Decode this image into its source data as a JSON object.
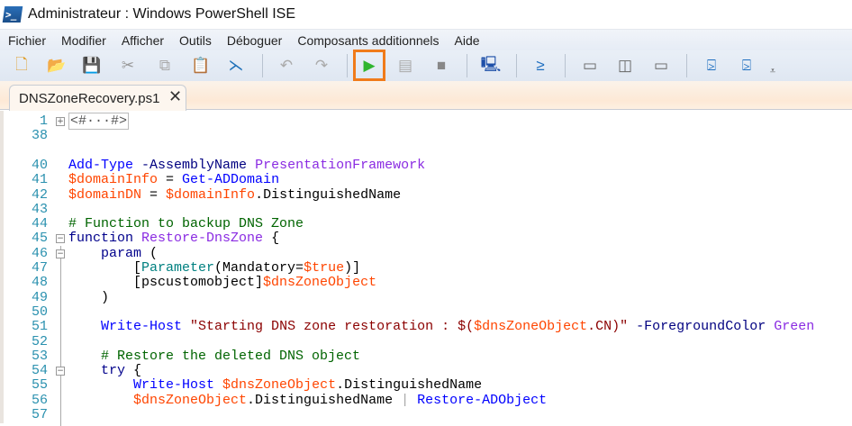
{
  "window": {
    "title": "Administrateur : Windows PowerShell ISE"
  },
  "menu": [
    "Fichier",
    "Modifier",
    "Afficher",
    "Outils",
    "Déboguer",
    "Composants additionnels",
    "Aide"
  ],
  "toolbar": [
    {
      "name": "new-file",
      "glyph": "🗋",
      "color": "#e0a030"
    },
    {
      "name": "open-file",
      "glyph": "📂",
      "color": "#d9a640"
    },
    {
      "name": "save",
      "glyph": "💾",
      "color": "#1f5fa8"
    },
    {
      "name": "cut",
      "glyph": "✂",
      "color": "#999"
    },
    {
      "name": "copy",
      "glyph": "⧉",
      "color": "#aaa"
    },
    {
      "name": "paste",
      "glyph": "📋",
      "color": "#333"
    },
    {
      "name": "clear-console",
      "glyph": "⋋",
      "color": "#1c6fb8"
    },
    {
      "name": "undo",
      "glyph": "↶",
      "color": "#aaa"
    },
    {
      "name": "redo",
      "glyph": "↷",
      "color": "#aaa"
    },
    {
      "name": "run-script",
      "glyph": "▶",
      "color": "#2fb52f"
    },
    {
      "name": "run-selection",
      "glyph": "▤",
      "color": "#aaa"
    },
    {
      "name": "stop",
      "glyph": "■",
      "color": "#888"
    },
    {
      "name": "remote-tab",
      "glyph": "🖳",
      "color": "#1d4fa8"
    },
    {
      "name": "start-powershell",
      "glyph": "≥",
      "color": "#1f6fc0"
    },
    {
      "name": "show-script-top",
      "glyph": "▭",
      "color": "#666"
    },
    {
      "name": "show-script-right",
      "glyph": "◫",
      "color": "#666"
    },
    {
      "name": "show-script-maximized",
      "glyph": "▭",
      "color": "#666"
    },
    {
      "name": "show-console-top",
      "glyph": "⍄",
      "color": "#1f6fc0"
    },
    {
      "name": "show-console-right",
      "glyph": "⍄",
      "color": "#1f6fc0"
    }
  ],
  "tab": {
    "label": "DNSZoneRecovery.ps1",
    "close": "✕"
  },
  "code": [
    {
      "n": "1",
      "fold": "+",
      "t": [
        [
          "<#···#>",
          "collapsed"
        ]
      ]
    },
    {
      "n": "38",
      "t": []
    },
    {
      "n": "",
      "t": []
    },
    {
      "n": "40",
      "t": [
        [
          "Add-Type",
          "cmd"
        ],
        [
          " ",
          "plain"
        ],
        [
          "-AssemblyName",
          "par"
        ],
        [
          " ",
          "plain"
        ],
        [
          "PresentationFramework",
          "arg"
        ]
      ]
    },
    {
      "n": "41",
      "t": [
        [
          "$domainInfo",
          "var"
        ],
        [
          " = ",
          "plain"
        ],
        [
          "Get-ADDomain",
          "cmd"
        ]
      ]
    },
    {
      "n": "42",
      "t": [
        [
          "$domainDN",
          "var"
        ],
        [
          " = ",
          "plain"
        ],
        [
          "$domainInfo",
          "var"
        ],
        [
          ".DistinguishedName",
          "plain"
        ]
      ]
    },
    {
      "n": "43",
      "t": []
    },
    {
      "n": "44",
      "t": [
        [
          "# Function to backup DNS Zone",
          "com"
        ]
      ]
    },
    {
      "n": "45",
      "fold": "−",
      "t": [
        [
          "function",
          "kw"
        ],
        [
          " ",
          "plain"
        ],
        [
          "Restore-DnsZone",
          "arg"
        ],
        [
          " {",
          "plain"
        ]
      ]
    },
    {
      "n": "46",
      "fold": "−",
      "t": [
        [
          "    param",
          "kw"
        ],
        [
          " (",
          "plain"
        ]
      ]
    },
    {
      "n": "47",
      "t": [
        [
          "        [",
          "plain"
        ],
        [
          "Parameter",
          "type"
        ],
        [
          "(Mandatory=",
          "plain"
        ],
        [
          "$true",
          "var"
        ],
        [
          ")]",
          "plain"
        ]
      ]
    },
    {
      "n": "48",
      "t": [
        [
          "        [pscustomobject]",
          "plain"
        ],
        [
          "$dnsZoneObject",
          "var"
        ]
      ]
    },
    {
      "n": "49",
      "t": [
        [
          "    )",
          "plain"
        ]
      ]
    },
    {
      "n": "50",
      "t": []
    },
    {
      "n": "51",
      "t": [
        [
          "    Write-Host",
          "cmd"
        ],
        [
          " ",
          "plain"
        ],
        [
          "\"Starting DNS zone restoration : $(",
          "str"
        ],
        [
          "$dnsZoneObject",
          "var"
        ],
        [
          ".CN)\"",
          "str"
        ],
        [
          " ",
          "plain"
        ],
        [
          "-ForegroundColor",
          "par"
        ],
        [
          " ",
          "plain"
        ],
        [
          "Green",
          "arg"
        ]
      ]
    },
    {
      "n": "52",
      "t": []
    },
    {
      "n": "53",
      "t": [
        [
          "    # Restore the deleted DNS object",
          "com"
        ]
      ]
    },
    {
      "n": "54",
      "fold": "−",
      "t": [
        [
          "    try",
          "kw"
        ],
        [
          " {",
          "plain"
        ]
      ]
    },
    {
      "n": "55",
      "t": [
        [
          "        Write-Host",
          "cmd"
        ],
        [
          " ",
          "plain"
        ],
        [
          "$dnsZoneObject",
          "var"
        ],
        [
          ".DistinguishedName",
          "plain"
        ]
      ]
    },
    {
      "n": "56",
      "t": [
        [
          "        $dnsZoneObject",
          "var"
        ],
        [
          ".DistinguishedName ",
          "plain"
        ],
        [
          "|",
          "op"
        ],
        [
          " ",
          "plain"
        ],
        [
          "Restore-ADObject",
          "cmd"
        ]
      ]
    },
    {
      "n": "57",
      "t": []
    }
  ]
}
